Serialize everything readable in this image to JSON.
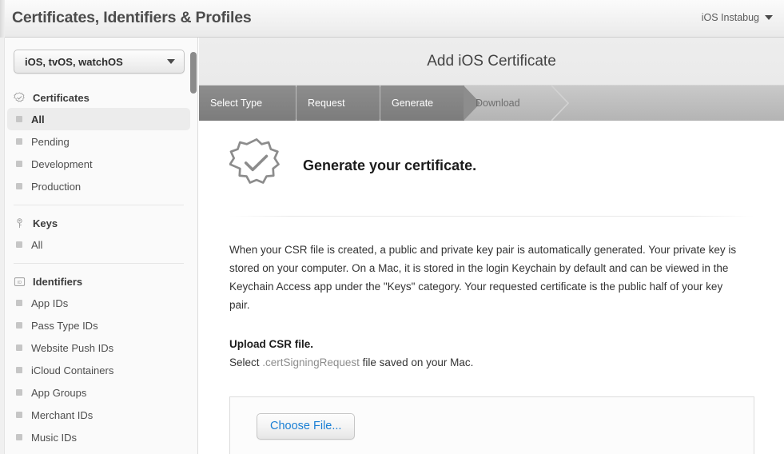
{
  "topbar": {
    "title": "Certificates, Identifiers & Profiles",
    "account": "iOS Instabug",
    "account_caret": "chevron-down-icon"
  },
  "sidebar": {
    "platform_select": {
      "value": "iOS, tvOS, watchOS",
      "caret": "chevron-down-icon"
    },
    "sections": [
      {
        "label": "Certificates",
        "icon": "certificate-badge-icon",
        "items": [
          {
            "label": "All",
            "active": true
          },
          {
            "label": "Pending",
            "active": false
          },
          {
            "label": "Development",
            "active": false
          },
          {
            "label": "Production",
            "active": false
          }
        ]
      },
      {
        "label": "Keys",
        "icon": "key-icon",
        "items": [
          {
            "label": "All",
            "active": false
          }
        ]
      },
      {
        "label": "Identifiers",
        "icon": "id-badge-icon",
        "items": [
          {
            "label": "App IDs",
            "active": false
          },
          {
            "label": "Pass Type IDs",
            "active": false
          },
          {
            "label": "Website Push IDs",
            "active": false
          },
          {
            "label": "iCloud Containers",
            "active": false
          },
          {
            "label": "App Groups",
            "active": false
          },
          {
            "label": "Merchant IDs",
            "active": false
          },
          {
            "label": "Music IDs",
            "active": false
          }
        ]
      }
    ]
  },
  "main": {
    "title": "Add iOS Certificate",
    "steps": [
      {
        "label": "Select Type",
        "state": "done"
      },
      {
        "label": "Request",
        "state": "done"
      },
      {
        "label": "Generate",
        "state": "done"
      },
      {
        "label": "Download",
        "state": "todo"
      }
    ],
    "heading": "Generate your certificate.",
    "heading_icon": "certificate-badge-icon",
    "paragraph": "When your CSR file is created, a public and private key pair is automatically generated. Your private key is stored on your computer. On a Mac, it is stored in the login Keychain by default and can be viewed in the Keychain Access app under the \"Keys\" category. Your requested certificate is the public half of your key pair.",
    "upload_title": "Upload CSR file.",
    "upload_sub_prefix": "Select ",
    "upload_sub_filetype": ".certSigningRequest",
    "upload_sub_suffix": " file saved on your Mac.",
    "choose_file_label": "Choose File..."
  },
  "colors": {
    "link_blue": "#1a7fd4",
    "step_active_bg": "#7c7c7c",
    "step_inactive_bg": "#bebebe",
    "sidebar_bg": "#fafafa"
  }
}
